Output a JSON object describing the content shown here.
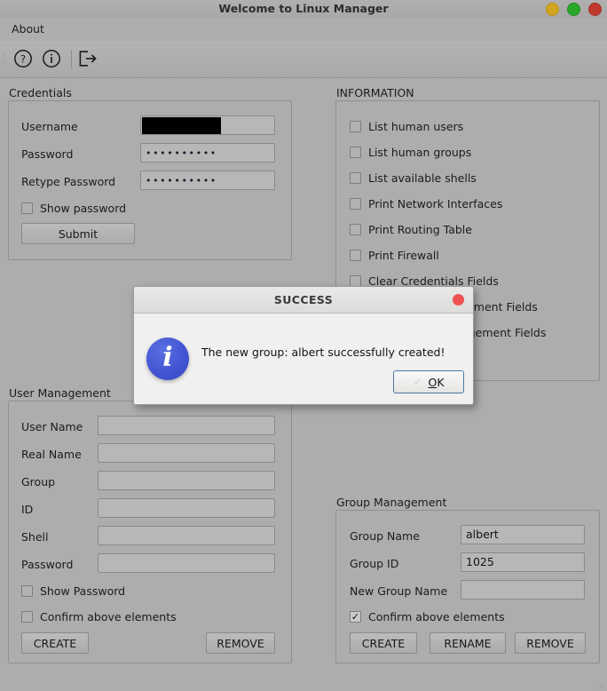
{
  "window": {
    "title": "Welcome to Linux Manager",
    "buttons": [
      {
        "name": "minimize",
        "color": "#d2a521"
      },
      {
        "name": "maximize",
        "color": "#2aa82a"
      },
      {
        "name": "close",
        "color": "#c0392f"
      }
    ]
  },
  "menubar": {
    "items": [
      {
        "label": "About"
      }
    ]
  },
  "toolbar": {
    "items": [
      {
        "icon": "help-circle-icon",
        "tooltip": "Help"
      },
      {
        "icon": "info-circle-icon",
        "tooltip": "Info"
      },
      {
        "icon": "logout-icon",
        "tooltip": "Exit"
      }
    ]
  },
  "credentials": {
    "title": "Credentials",
    "fields": [
      {
        "label": "Username",
        "value": "",
        "redacted": true,
        "type": "text"
      },
      {
        "label": "Password",
        "value": "••••••••••",
        "redacted": false,
        "type": "password"
      },
      {
        "label": "Retype Password",
        "value": "••••••••••",
        "redacted": false,
        "type": "password"
      }
    ],
    "show_password": {
      "label": "Show password",
      "checked": false
    },
    "submit_label": "Submit"
  },
  "information": {
    "title": "INFORMATION",
    "checkboxes": [
      {
        "label": "List human users",
        "checked": false
      },
      {
        "label": "List human groups",
        "checked": false
      },
      {
        "label": "List available shells",
        "checked": false
      },
      {
        "label": "Print Network Interfaces",
        "checked": false
      },
      {
        "label": "Print Routing Table",
        "checked": false
      },
      {
        "label": "Print Firewall",
        "checked": false
      },
      {
        "label": "Clear Credentials Fields",
        "checked": false
      },
      {
        "label": "Clear User Management Fields",
        "checked": false
      },
      {
        "label": "Clear Group Management Fields",
        "checked": false
      }
    ]
  },
  "user_management": {
    "title": "User Management",
    "fields": [
      {
        "label": "User Name",
        "value": ""
      },
      {
        "label": "Real Name",
        "value": ""
      },
      {
        "label": "Group",
        "value": ""
      },
      {
        "label": "ID",
        "value": ""
      },
      {
        "label": "Shell",
        "value": ""
      },
      {
        "label": "Password",
        "value": ""
      }
    ],
    "show_password": {
      "label": "Show Password",
      "checked": false
    },
    "confirm": {
      "label": "Confirm above elements",
      "checked": false
    },
    "buttons": [
      {
        "label": "CREATE"
      },
      {
        "label": "REMOVE"
      }
    ]
  },
  "group_management": {
    "title": "Group Management",
    "fields": [
      {
        "label": "Group Name",
        "value": "albert"
      },
      {
        "label": "Group ID",
        "value": "1025"
      },
      {
        "label": "New Group Name",
        "value": ""
      }
    ],
    "confirm": {
      "label": "Confirm above elements",
      "checked": true
    },
    "buttons": [
      {
        "label": "CREATE"
      },
      {
        "label": "RENAME"
      },
      {
        "label": "REMOVE"
      }
    ]
  },
  "dialog": {
    "title": "SUCCESS",
    "message": "The new group: albert successfully created!",
    "icon": "info-icon",
    "ok_label": "OK",
    "close_color": "#ef5350"
  }
}
